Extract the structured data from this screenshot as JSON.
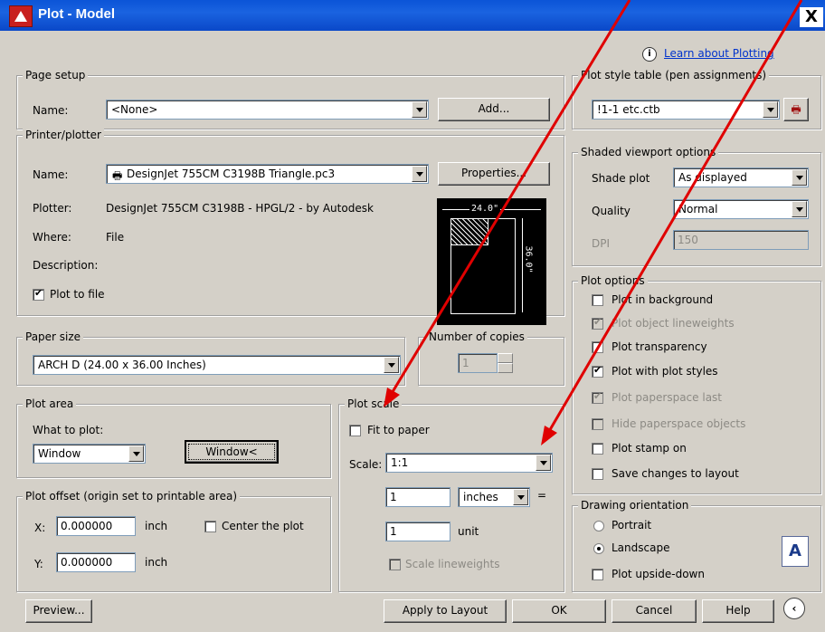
{
  "window": {
    "title": "Plot - Model",
    "close": "X"
  },
  "learn": {
    "text": "Learn about Plotting"
  },
  "page_setup": {
    "legend": "Page setup",
    "name_label": "Name:",
    "name_value": "<None>",
    "add_button": "Add..."
  },
  "printer": {
    "legend": "Printer/plotter",
    "name_label": "Name:",
    "name_value": "DesignJet 755CM C3198B Triangle.pc3",
    "properties_button": "Properties...",
    "plotter_label": "Plotter:",
    "plotter_value": "DesignJet 755CM C3198B - HPGL/2 - by Autodesk",
    "where_label": "Where:",
    "where_value": "File",
    "description_label": "Description:",
    "plot_to_file": "Plot to file",
    "preview_width": "24.0\"",
    "preview_height": "36.0\""
  },
  "paper_size": {
    "legend": "Paper size",
    "value": "ARCH D (24.00 x 36.00 Inches)"
  },
  "copies": {
    "legend": "Number of copies",
    "value": "1"
  },
  "plot_area": {
    "legend": "Plot area",
    "what_label": "What to plot:",
    "what_value": "Window",
    "window_button": "Window<"
  },
  "plot_offset": {
    "legend": "Plot offset (origin set to printable area)",
    "x_label": "X:",
    "x_value": "0.000000",
    "x_unit": "inch",
    "y_label": "Y:",
    "y_value": "0.000000",
    "y_unit": "inch",
    "center": "Center the plot"
  },
  "plot_scale": {
    "legend": "Plot scale",
    "fit": "Fit to paper",
    "scale_label": "Scale:",
    "scale_value": "1:1",
    "num": "1",
    "num_unit": "inches",
    "equals": "=",
    "den": "1",
    "den_unit": "unit",
    "scale_lw": "Scale lineweights"
  },
  "style_table": {
    "legend": "Plot style table (pen assignments)",
    "value": "!1-1 etc.ctb"
  },
  "shaded": {
    "legend": "Shaded viewport options",
    "shade_label": "Shade plot",
    "shade_value": "As displayed",
    "quality_label": "Quality",
    "quality_value": "Normal",
    "dpi_label": "DPI",
    "dpi_value": "150"
  },
  "options": {
    "legend": "Plot options",
    "items": [
      "Plot in background",
      "Plot object lineweights",
      "Plot transparency",
      "Plot with plot styles",
      "Plot paperspace last",
      "Hide paperspace objects",
      "Plot stamp on",
      "Save changes to layout"
    ]
  },
  "orientation": {
    "legend": "Drawing orientation",
    "portrait": "Portrait",
    "landscape": "Landscape",
    "upside": "Plot upside-down",
    "icon": "A"
  },
  "footer": {
    "preview": "Preview...",
    "apply": "Apply to Layout",
    "ok": "OK",
    "cancel": "Cancel",
    "help": "Help"
  },
  "colors": {
    "title_bar": "#0b54d7",
    "dialog_bg": "#d4d0c8",
    "annotation_arrow": "#e00000"
  }
}
